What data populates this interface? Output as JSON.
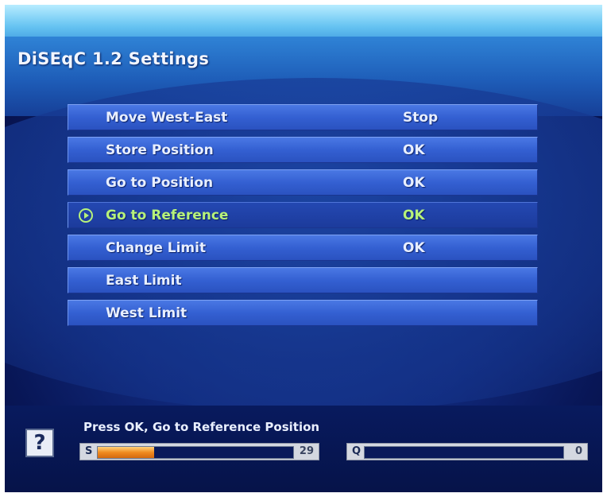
{
  "title": "DiSEqC 1.2 Settings",
  "menu": [
    {
      "label": "Move West-East",
      "value": "Stop"
    },
    {
      "label": "Store Position",
      "value": "OK"
    },
    {
      "label": "Go to Position",
      "value": "OK"
    },
    {
      "label": "Go to Reference",
      "value": "OK",
      "selected": true
    },
    {
      "label": "Change Limit",
      "value": "OK"
    },
    {
      "label": "East Limit",
      "value": ""
    },
    {
      "label": "West Limit",
      "value": ""
    }
  ],
  "help": {
    "icon": "help-icon",
    "glyph": "?",
    "text": "Press OK, Go to Reference Position"
  },
  "meters": {
    "signal": {
      "tag": "S",
      "value": "29",
      "level": 0.29
    },
    "quality": {
      "tag": "Q",
      "value": "0",
      "level": 0
    }
  },
  "colors": {
    "selected_text": "#b7f27a",
    "signal_fill": "#f08a20"
  }
}
